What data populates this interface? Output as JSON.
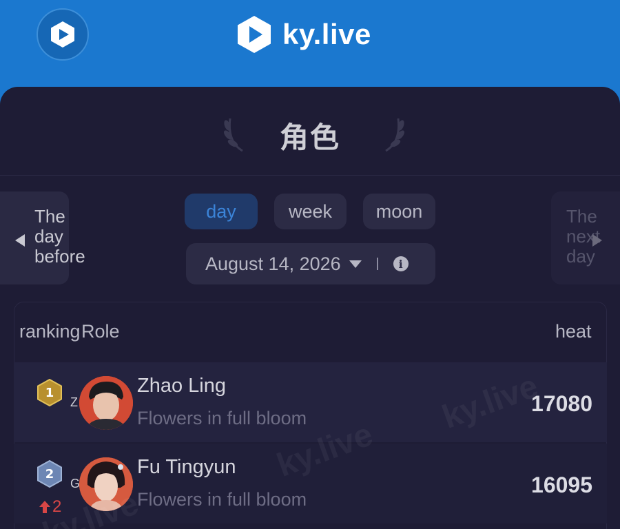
{
  "header": {
    "app_icon": "play-logo-icon",
    "logo_text": "ky.live",
    "brand_color": "#1b78cf"
  },
  "page": {
    "title": "角色"
  },
  "nav": {
    "prev_label": "The day before",
    "next_label": "The next day"
  },
  "tabs": [
    {
      "label": "day",
      "active": true
    },
    {
      "label": "week",
      "active": false
    },
    {
      "label": "moon",
      "active": false
    }
  ],
  "date_picker": {
    "value": "August 14, 2026",
    "caret_icon": "caret-down-icon",
    "info_icon": "info-icon"
  },
  "table": {
    "headers": {
      "ranking": "ranking",
      "role": "Role",
      "heat": "heat"
    },
    "rows": [
      {
        "rank": "1",
        "rank_color": "#b8902e",
        "avatar_alt": "Zhao Ling",
        "name": "Zhao Ling",
        "drama": "Flowers in full bloom",
        "heat": "17080",
        "change": ""
      },
      {
        "rank": "2",
        "rank_color": "#6d86b4",
        "avatar_alt": "Fu Tingyun",
        "name": "Fu Tingyun",
        "drama": "Flowers in full bloom",
        "heat": "16095",
        "change": "2"
      }
    ]
  },
  "watermark_text": "ky.live"
}
